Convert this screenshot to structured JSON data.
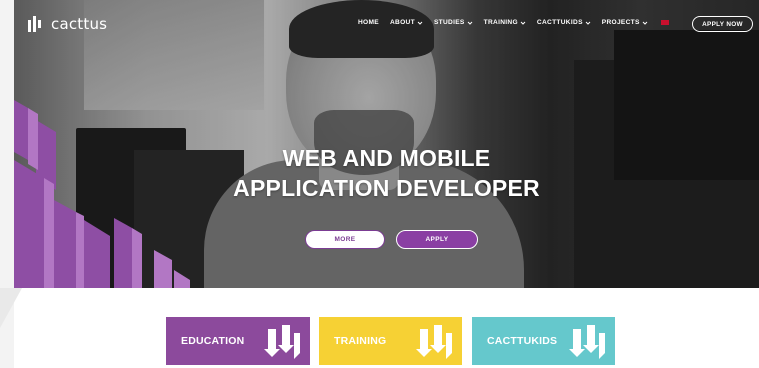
{
  "brand": {
    "name": "cacttus",
    "logo_icon": "cacttus-bars-logo"
  },
  "nav": {
    "items": [
      {
        "label": "HOME",
        "has_dropdown": false
      },
      {
        "label": "ABOUT",
        "has_dropdown": true
      },
      {
        "label": "STUDIES",
        "has_dropdown": true
      },
      {
        "label": "TRAINING",
        "has_dropdown": true
      },
      {
        "label": "CACTTUKIDS",
        "has_dropdown": true
      },
      {
        "label": "PROJECTS",
        "has_dropdown": true
      }
    ],
    "language_flag": "albanian-flag-icon",
    "apply_now": "APPLY NOW"
  },
  "hero": {
    "title_line1": "WEB AND MOBILE",
    "title_line2": "APPLICATION DEVELOPER",
    "more_label": "MORE",
    "apply_label": "APPLY"
  },
  "tiles": [
    {
      "label": "EDUCATION",
      "color": "#8c4a9c"
    },
    {
      "label": "TRAINING",
      "color": "#f6d134"
    },
    {
      "label": "CACTTUKIDS",
      "color": "#65c8cc"
    }
  ],
  "colors": {
    "accent": "#8a3fa3",
    "white": "#ffffff"
  }
}
